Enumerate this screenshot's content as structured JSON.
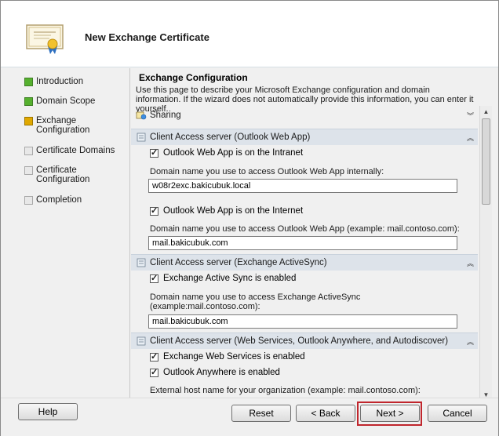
{
  "window": {
    "title": "New Exchange Certificate"
  },
  "sidebar": {
    "items": [
      {
        "label": "Introduction",
        "state": "done"
      },
      {
        "label": "Domain Scope",
        "state": "done"
      },
      {
        "label": "Exchange Configuration",
        "state": "current"
      },
      {
        "label": "Certificate Domains",
        "state": "pending"
      },
      {
        "label": "Certificate Configuration",
        "state": "pending"
      },
      {
        "label": "Completion",
        "state": "pending"
      }
    ]
  },
  "page": {
    "heading": "Exchange Configuration",
    "description": "Use this page to describe your Microsoft Exchange configuration and domain information. If the wizard does not automatically provide this information, you can enter it yourself."
  },
  "sections": {
    "sharing": {
      "title": "Sharing"
    },
    "owa": {
      "title": "Client Access server (Outlook Web App)",
      "intranet_checkbox": "Outlook Web App is on the Intranet",
      "intranet_label": "Domain name you use to access Outlook Web App internally:",
      "intranet_value": "w08r2exc.bakicubuk.local",
      "internet_checkbox": "Outlook Web App is on the Internet",
      "internet_label": "Domain name you use to access Outlook Web App (example: mail.contoso.com):",
      "internet_value": "mail.bakicubuk.com"
    },
    "activesync": {
      "title": "Client Access server (Exchange ActiveSync)",
      "checkbox": "Exchange Active Sync is enabled",
      "label": "Domain name you use to access Exchange ActiveSync (example:mail.contoso.com):",
      "value": "mail.bakicubuk.com"
    },
    "webservices": {
      "title": "Client Access server (Web Services, Outlook Anywhere, and Autodiscover)",
      "ews_checkbox": "Exchange Web Services is enabled",
      "oa_checkbox": "Outlook Anywhere is enabled",
      "external_label": "External host name for your organization (example: mail.contoso.com):"
    }
  },
  "buttons": {
    "help": "Help",
    "reset": "Reset",
    "back": "< Back",
    "next": "Next >",
    "cancel": "Cancel"
  },
  "colors": {
    "accent_highlight": "#c0262d",
    "done": "#56b02f",
    "current": "#e0a800"
  }
}
